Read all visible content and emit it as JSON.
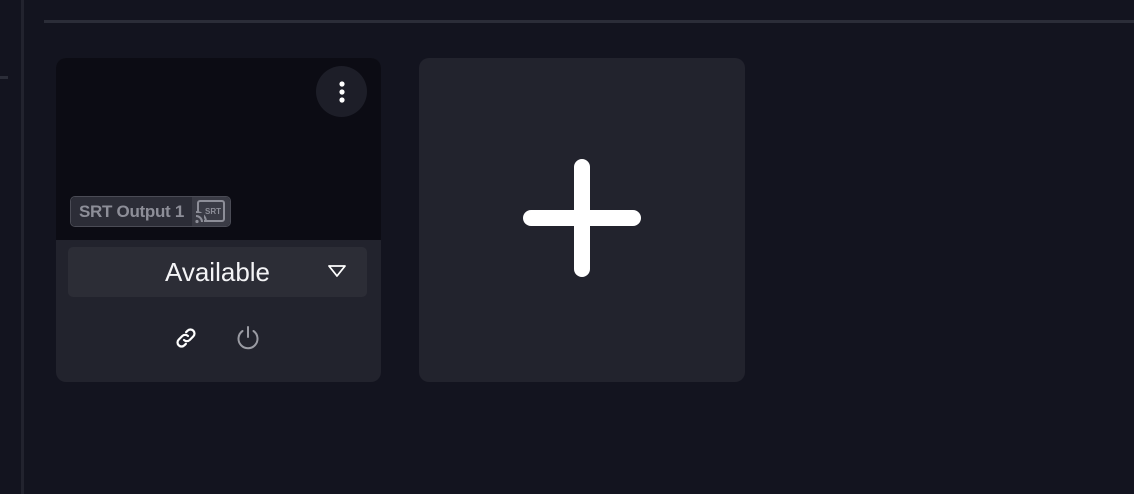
{
  "output_card": {
    "output_name": "SRT Output 1",
    "output_type_label": "SRT",
    "status": "Available",
    "actions": {
      "link_icon": "link-icon",
      "power_icon": "power-icon"
    },
    "menu_icon": "more-vertical-icon"
  },
  "add_output": {
    "icon": "plus-icon"
  },
  "colors": {
    "background": "#13141f",
    "card": "#22232d",
    "preview": "#0c0c14",
    "select": "#2c2d36",
    "text": "#ffffff",
    "muted_text": "#8d8e98"
  }
}
